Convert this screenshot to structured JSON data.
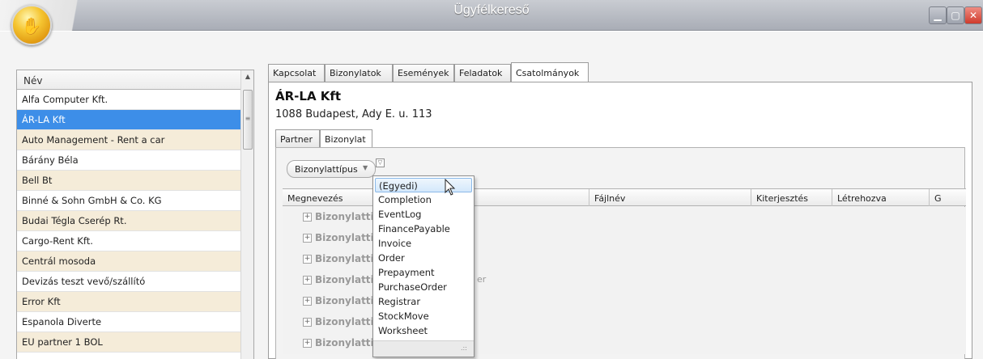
{
  "window": {
    "title": "Ügyfélkereső",
    "app_icon": "coin-hand-icon",
    "minimize_icon": "minimize-icon",
    "maximize_icon": "maximize-icon",
    "close_icon": "close-icon"
  },
  "partner_list": {
    "header": "Név",
    "items": [
      {
        "name": "Alfa Computer Kft."
      },
      {
        "name": "ÁR-LA Kft",
        "selected": true
      },
      {
        "name": "Auto Management - Rent a car"
      },
      {
        "name": "Bárány Béla"
      },
      {
        "name": "Bell Bt"
      },
      {
        "name": "Binné & Sohn GmbH & Co. KG"
      },
      {
        "name": "Budai Tégla Cserép Rt."
      },
      {
        "name": "Cargo-Rent Kft."
      },
      {
        "name": "Centrál mosoda"
      },
      {
        "name": "Devizás teszt vevő/szállító"
      },
      {
        "name": "Error Kft"
      },
      {
        "name": "Espanola Diverte"
      },
      {
        "name": "EU partner 1 BOL"
      }
    ]
  },
  "main_tabs": [
    {
      "label": "Kapcsolat"
    },
    {
      "label": "Bizonylatok"
    },
    {
      "label": "Események"
    },
    {
      "label": "Feladatok"
    },
    {
      "label": "Csatolmányok",
      "active": true
    }
  ],
  "partner": {
    "name": "ÁR-LA Kft",
    "address": "1088 Budapest, Ady E. u. 113"
  },
  "sub_tabs": [
    {
      "label": "Partner"
    },
    {
      "label": "Bizonylat",
      "active": true
    }
  ],
  "group_by": {
    "chip_label": "Bizonylattípus",
    "sort_icon": "sort-desc-icon",
    "filter_icon": "filter-icon"
  },
  "grid": {
    "columns": [
      "Megnevezés",
      "Fájlnév",
      "Kiterjesztés",
      "Létrehozva",
      "G"
    ],
    "group_row_label": "Bizonylatti",
    "rows": [
      {
        "label": "Bizonylatti",
        "extra": ""
      },
      {
        "label": "Bizonylatti",
        "extra": ""
      },
      {
        "label": "Bizonylatti",
        "extra": ""
      },
      {
        "label": "Bizonylatti",
        "extra": "er"
      },
      {
        "label": "Bizonylatti",
        "extra": ""
      },
      {
        "label": "Bizonylatti",
        "extra": ""
      },
      {
        "label": "Bizonylatti",
        "extra": ""
      }
    ]
  },
  "filter_popup": {
    "items": [
      {
        "label": "(Egyedi)",
        "hover": true
      },
      {
        "label": "Completion"
      },
      {
        "label": "EventLog"
      },
      {
        "label": "FinancePayable"
      },
      {
        "label": "Invoice"
      },
      {
        "label": "Order"
      },
      {
        "label": "Prepayment"
      },
      {
        "label": "PurchaseOrder"
      },
      {
        "label": "Registrar"
      },
      {
        "label": "StockMove"
      },
      {
        "label": "Worksheet"
      }
    ],
    "resize_icon": "resize-grip-icon"
  },
  "cursor_icon": "mouse-pointer-icon"
}
